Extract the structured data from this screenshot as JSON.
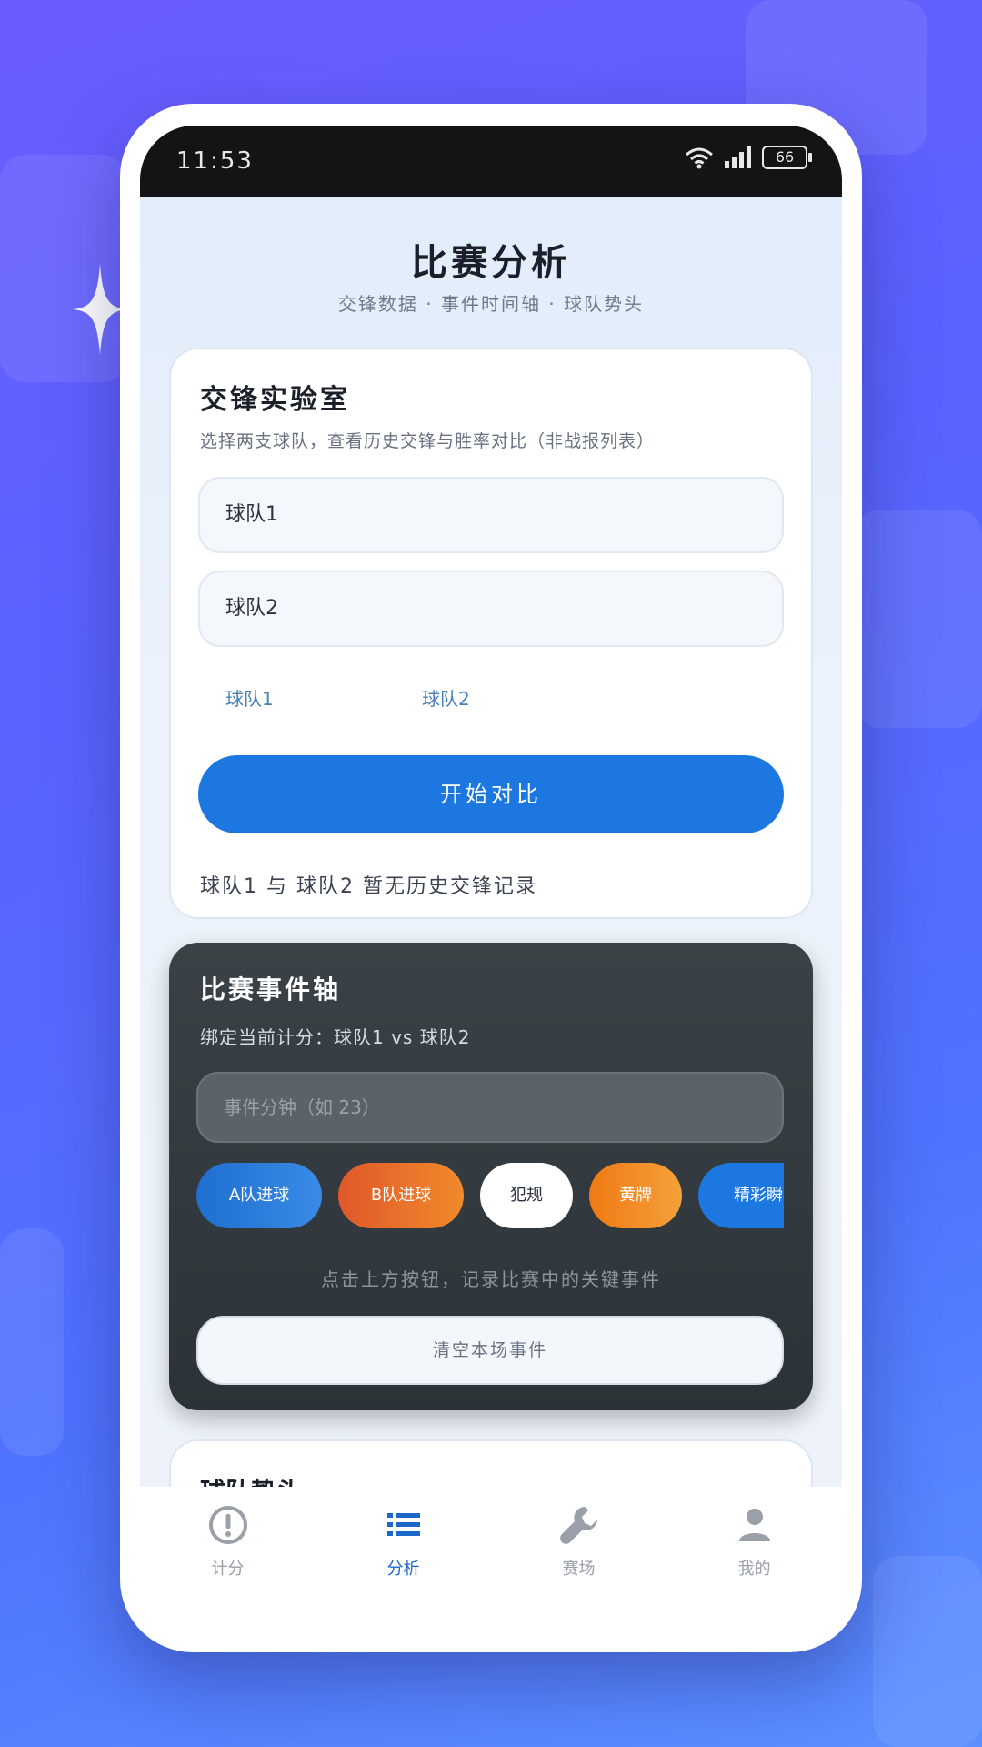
{
  "status_bar": {
    "time": "11:53",
    "battery": "66"
  },
  "page": {
    "title": "比赛分析",
    "subtitle": "交锋数据 · 事件时间轴 · 球队势头"
  },
  "h2h_card": {
    "title": "交锋实验室",
    "description": "选择两支球队，查看历史交锋与胜率对比（非战报列表）",
    "team1_input": "球队1",
    "team2_input": "球队2",
    "tag_team1": "球队1",
    "tag_team2": "球队2",
    "compare_button": "开始对比",
    "note": "球队1 与 球队2 暂无历史交锋记录"
  },
  "timeline_card": {
    "title": "比赛事件轴",
    "score": "绑定当前计分：球队1 vs 球队2",
    "minute_placeholder": "事件分钟（如 23）",
    "chips": [
      {
        "label": "A队进球",
        "color": "#2a7ad8"
      },
      {
        "label": "B队进球",
        "color": "#e86a2a"
      },
      {
        "label": "犯规",
        "color": "#ffffff"
      },
      {
        "label": "黄牌",
        "color": "#f08a1c"
      },
      {
        "label": "精彩瞬间",
        "color": "#1c78e0"
      }
    ],
    "hint": "点击上方按钮，记录比赛中的关键事件",
    "clear_button": "清空本场事件"
  },
  "peek_card": {
    "title": "球队势头"
  },
  "tabbar": {
    "items": [
      {
        "label": "计分",
        "icon": "alert-circle-icon"
      },
      {
        "label": "分析",
        "icon": "list-icon"
      },
      {
        "label": "赛场",
        "icon": "wrench-icon"
      },
      {
        "label": "我的",
        "icon": "person-icon"
      }
    ],
    "active_index": 1
  },
  "colors": {
    "accent": "#1c78e0",
    "dark_card": "#323a3f",
    "status_bar": "#141414"
  }
}
